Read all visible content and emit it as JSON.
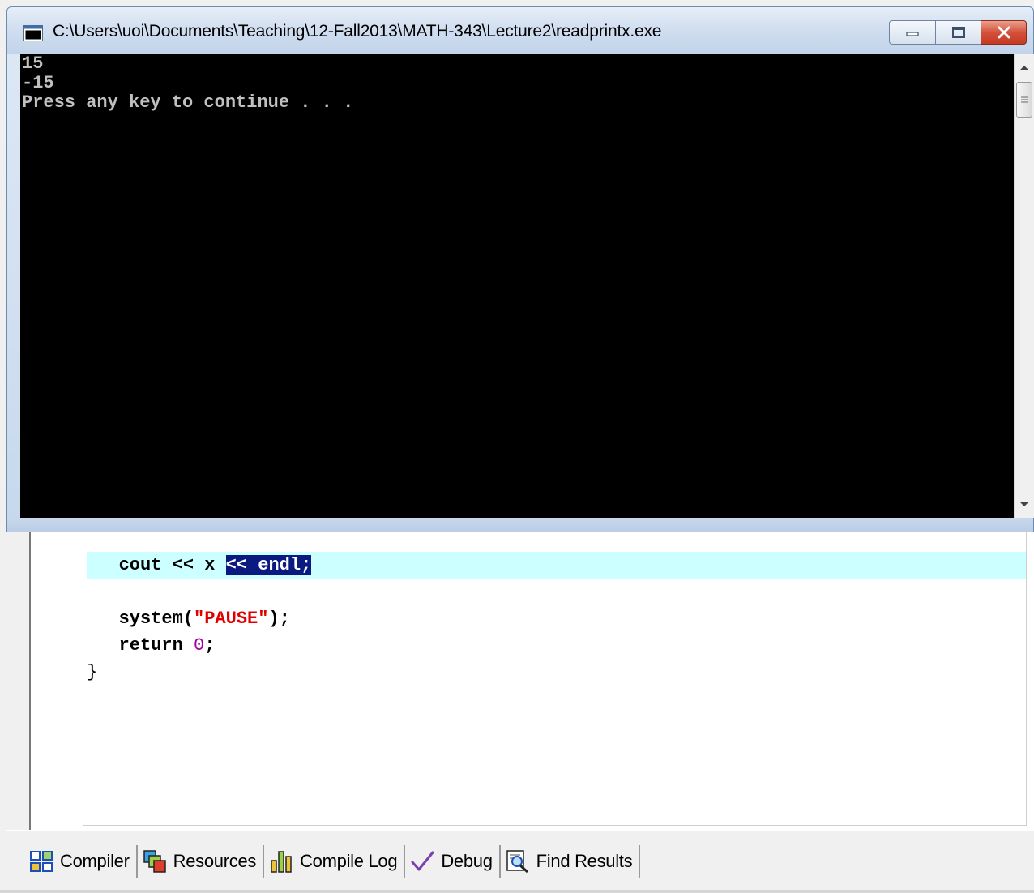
{
  "console": {
    "title": "C:\\Users\\uoi\\Documents\\Teaching\\12-Fall2013\\MATH-343\\Lecture2\\readprintx.exe",
    "output_lines": [
      "15",
      "-15",
      "Press any key to continue . . ."
    ]
  },
  "editor": {
    "line1": {
      "indent": "   ",
      "kw": "cout",
      "mid": " << x ",
      "selected": "<< endl;"
    },
    "line2": {
      "indent": "   ",
      "fn": "system(",
      "str": "\"PAUSE\"",
      "tail": ");"
    },
    "line3": {
      "indent": "   ",
      "kw": "return",
      "sp": " ",
      "num": "0",
      "tail": ";"
    },
    "line4": {
      "text": "}"
    },
    "active_line_color": "#ccffff",
    "selection_color": "#0a1a80"
  },
  "tabs": [
    {
      "label": "Compiler",
      "icon": "compiler-grid-icon"
    },
    {
      "label": "Resources",
      "icon": "resources-icon"
    },
    {
      "label": "Compile Log",
      "icon": "bar-chart-icon"
    },
    {
      "label": "Debug",
      "icon": "checkmark-icon"
    },
    {
      "label": "Find Results",
      "icon": "find-results-icon"
    }
  ]
}
